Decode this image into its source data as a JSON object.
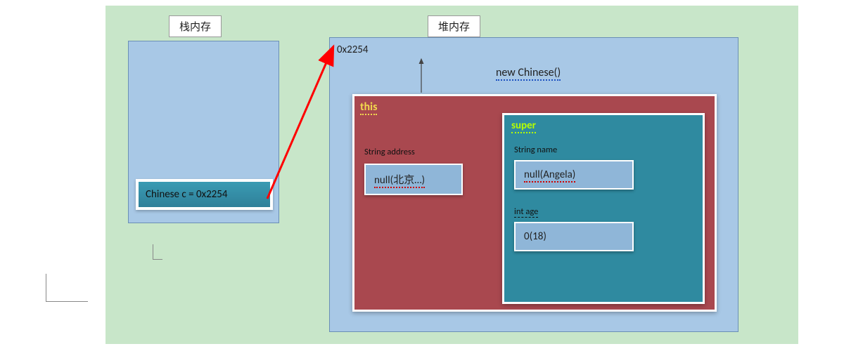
{
  "labels": {
    "stack_title": "栈内存",
    "heap_title": "堆内存"
  },
  "stack": {
    "variable": "Chinese c = 0x2254"
  },
  "heap": {
    "address": "0x2254",
    "constructor_call": "new Chinese()",
    "this_box": {
      "keyword": "this",
      "fields": {
        "address": {
          "type_label": "String address",
          "value": "null(北京…)"
        }
      }
    },
    "super_box": {
      "keyword": "super",
      "fields": {
        "name": {
          "type_label": "String name",
          "value": "null(Angela)"
        },
        "age": {
          "type_label": "int age",
          "value": "0(18)"
        }
      }
    }
  },
  "arrows": {
    "stack_to_heap": {
      "from": "stack-variable",
      "to": "heap-address",
      "color": "#ff0000"
    },
    "constructor_to_address": {
      "from": "new-chinese",
      "to": "heap-address",
      "color": "#444"
    }
  }
}
